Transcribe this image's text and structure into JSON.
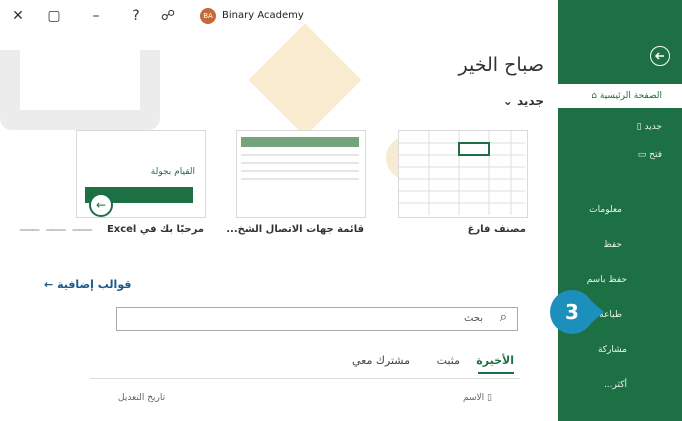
{
  "topbar": {
    "account_name": "Binary Academy",
    "avatar_initials": "BA",
    "icons": [
      "close-icon",
      "restore-icon",
      "minimize-icon",
      "help-icon",
      "feedback-icon"
    ]
  },
  "sidebar": {
    "items": [
      {
        "label": "الصفحة الرئيسية",
        "icon": "home-icon"
      },
      {
        "label": "جديد",
        "icon": "new-file-icon"
      },
      {
        "label": "فتح",
        "icon": "folder-open-icon"
      },
      {
        "label": "معلومات"
      },
      {
        "label": "حفظ"
      },
      {
        "label": "حفظ باسم"
      },
      {
        "label": "طباعة"
      },
      {
        "label": "مشاركة"
      },
      {
        "label": "أكثر..."
      }
    ],
    "color": "#1d7044"
  },
  "main": {
    "greeting": "صباح الخير",
    "new_section": "جديد",
    "templates": [
      {
        "caption": "مصنف فارغ"
      },
      {
        "caption": "قائمة جهات الاتصال الشخ..."
      },
      {
        "caption": "مرحبًا بك في Excel",
        "inner_text": "القيام بجولة"
      }
    ],
    "more_templates": "قوالب إضافية",
    "search_placeholder": "بحث",
    "tabs": [
      "الأخيرة",
      "مثبت",
      "مشترك معي"
    ],
    "columns": {
      "name": "الاسم",
      "modified": "تاريخ التعديل"
    }
  },
  "callout": {
    "number": "3",
    "color": "#1c8fbc"
  }
}
